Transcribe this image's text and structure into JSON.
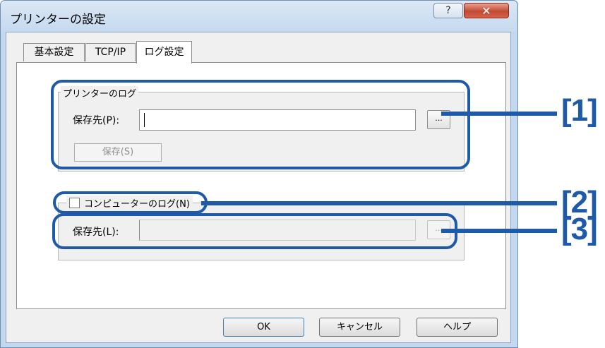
{
  "window": {
    "title": "プリンターの設定",
    "help_button": "?",
    "close_button": "✕"
  },
  "tabs": [
    {
      "label": "基本設定",
      "active": false
    },
    {
      "label": "TCP/IP",
      "active": false
    },
    {
      "label": "ログ設定",
      "active": true
    }
  ],
  "printer_log": {
    "legend": "プリンターのログ",
    "save_label": "保存先(P):",
    "path_value": "",
    "browse_label": "...",
    "save_button": "保存(S)"
  },
  "computer_log": {
    "checkbox_label": "コンピューターのログ(N)",
    "checked": false,
    "save_label": "保存先(L):",
    "path_value": "",
    "browse_label": "..."
  },
  "buttons": {
    "ok": "OK",
    "cancel": "キャンセル",
    "help": "ヘルプ"
  },
  "callouts": [
    "[1]",
    "[2]",
    "[3]"
  ],
  "colors": {
    "callout": "#1f5aa8",
    "title_bar": "#c5d9ef",
    "close_button": "#c24a34"
  }
}
